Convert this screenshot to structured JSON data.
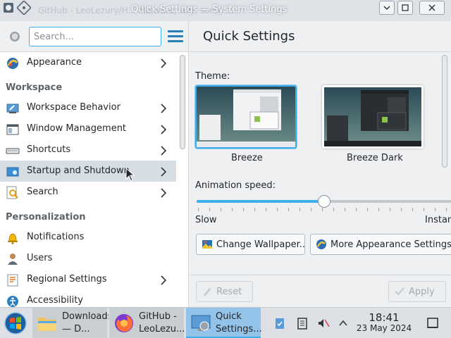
{
  "window": {
    "background_title": "GitHub - LeoLezury/H... Malware, with some ...",
    "title": "Quick Settings — System Settings"
  },
  "sidebar": {
    "search_placeholder": "Search...",
    "items": [
      {
        "label": "Appearance",
        "icon": "appearance-icon",
        "has_children": true
      },
      {
        "label": "Workspace Behavior",
        "icon": "workspace-behavior-icon",
        "has_children": true
      },
      {
        "label": "Window Management",
        "icon": "window-management-icon",
        "has_children": true
      },
      {
        "label": "Shortcuts",
        "icon": "keyboard-icon",
        "has_children": true
      },
      {
        "label": "Startup and Shutdown",
        "icon": "startup-icon",
        "has_children": true,
        "selected": true
      },
      {
        "label": "Search",
        "icon": "search-icon",
        "has_children": true
      },
      {
        "label": "Notifications",
        "icon": "bell-icon",
        "has_children": false
      },
      {
        "label": "Users",
        "icon": "users-icon",
        "has_children": false
      },
      {
        "label": "Regional Settings",
        "icon": "globe-icon",
        "has_children": true
      },
      {
        "label": "Accessibility",
        "icon": "accessibility-icon",
        "has_children": false
      }
    ],
    "sections": [
      "Workspace",
      "Personalization"
    ]
  },
  "main": {
    "title": "Quick Settings",
    "theme_label": "Theme:",
    "themes": [
      {
        "name": "Breeze",
        "selected": true
      },
      {
        "name": "Breeze Dark",
        "selected": false
      }
    ],
    "animation_label": "Animation speed:",
    "animation_speed": 0.49,
    "slow_label": "Slow",
    "instant_label": "Instant",
    "change_wallpaper": "Change Wallpaper...",
    "more_appearance": "More Appearance Settings...",
    "reset": "Reset",
    "apply": "Apply"
  },
  "taskbar": {
    "tasks": [
      {
        "label": "Downloads — D...",
        "icon": "folder-icon",
        "state": "open"
      },
      {
        "label": "GitHub - LeoLezu...",
        "icon": "firefox-icon",
        "state": "open"
      },
      {
        "label": "Quick Settings...",
        "icon": "system-settings-icon",
        "state": "active"
      }
    ],
    "time": "18:41",
    "date": "23 May 2024"
  },
  "colors": {
    "accent": "#3daee9",
    "selection": "#d6dde4",
    "taskbar": "#dde1e5"
  }
}
